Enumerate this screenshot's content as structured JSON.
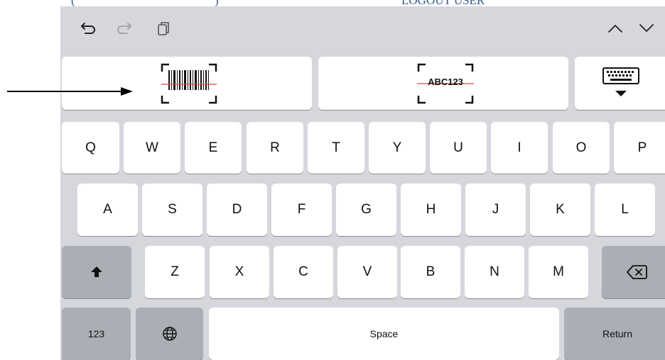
{
  "top_text": {
    "left": "(",
    "middle": ")",
    "right": "LOGOUT USER"
  },
  "toolbar": {
    "undo_icon": "undo-arrow-icon",
    "redo_icon": "redo-arrow-icon",
    "paste_icon": "clipboard-icon",
    "prev_icon": "chevron-up-icon",
    "next_icon": "chevron-down-icon"
  },
  "scan_bar": {
    "barcode_icon": "barcode-scan-icon",
    "text_scan_label": "ABC123",
    "hide_keyboard_icon": "keyboard-hide-icon"
  },
  "keys": {
    "row1": [
      "Q",
      "W",
      "E",
      "R",
      "T",
      "Y",
      "U",
      "I",
      "O",
      "P"
    ],
    "row2": [
      "A",
      "S",
      "D",
      "F",
      "G",
      "H",
      "J",
      "K",
      "L"
    ],
    "row3": [
      "Z",
      "X",
      "C",
      "V",
      "B",
      "N",
      "M"
    ],
    "numbers_label": "123",
    "space_label": "Space",
    "return_label": "Return"
  },
  "colors": {
    "keyboard_bg": "#d5d7dc",
    "key_bg": "#ffffff",
    "function_key_bg": "#abaeb5",
    "scan_line": "#e0473f"
  }
}
